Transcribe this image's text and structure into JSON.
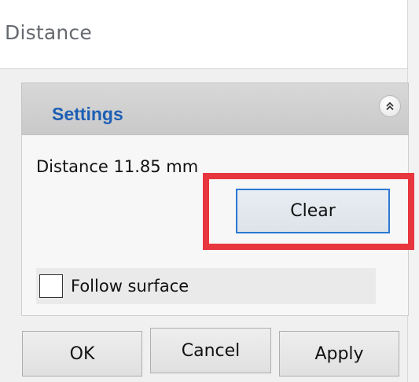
{
  "window": {
    "title": "Distance"
  },
  "settings": {
    "header": "Settings",
    "distance_text": "Distance 11.85 mm",
    "clear_label": "Clear",
    "follow_surface_label": "Follow surface",
    "follow_surface_checked": false
  },
  "footer": {
    "ok_label": "OK",
    "cancel_label": "Cancel",
    "apply_label": "Apply"
  },
  "icons": {
    "collapse": "double-chevron-up-icon"
  },
  "colors": {
    "accent": "#2a78d2",
    "header_text": "#1d5fb4",
    "highlight": "#e8363f"
  }
}
